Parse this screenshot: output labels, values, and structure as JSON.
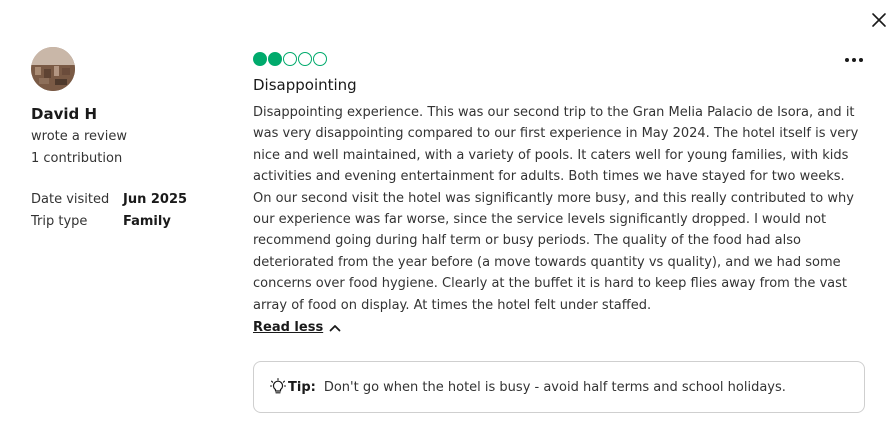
{
  "reviewer": {
    "name": "David H",
    "action": "wrote a review",
    "contributions": "1 contribution"
  },
  "details": [
    {
      "label": "Date visited",
      "value": "Jun 2025"
    },
    {
      "label": "Trip type",
      "value": "Family"
    }
  ],
  "review": {
    "rating": 2,
    "rating_max": 5,
    "title": "Disappointing",
    "body": "Disappointing experience. This was our second trip to the Gran Melia Palacio de Isora, and it was very disappointing compared to our first experience in May 2024. The hotel itself is very nice and well maintained, with a variety of pools. It caters well for young families, with kids activities and evening entertainment for adults. Both times we have stayed for two weeks. On our second visit the hotel was significantly more busy, and this really contributed to why our experience was far worse, since the service levels significantly dropped. I would not recommend going during half term or busy periods. The quality of the food had also deteriorated from the year before (a move towards quantity vs quality), and we had some concerns over food hygiene. Clearly at the buffet it is hard to keep flies away from the vast array of food on display. At times the hotel felt under staffed.",
    "read_less_label": "Read less"
  },
  "tip": {
    "label": "Tip:",
    "text": "Don't go when the hotel is busy - avoid half terms and school holidays."
  },
  "colors": {
    "rating_green": "#00aa6c"
  },
  "icons": {
    "close": "close-icon",
    "more": "more-options-icon",
    "chevron": "chevron-up-icon",
    "lightbulb": "lightbulb-icon"
  }
}
